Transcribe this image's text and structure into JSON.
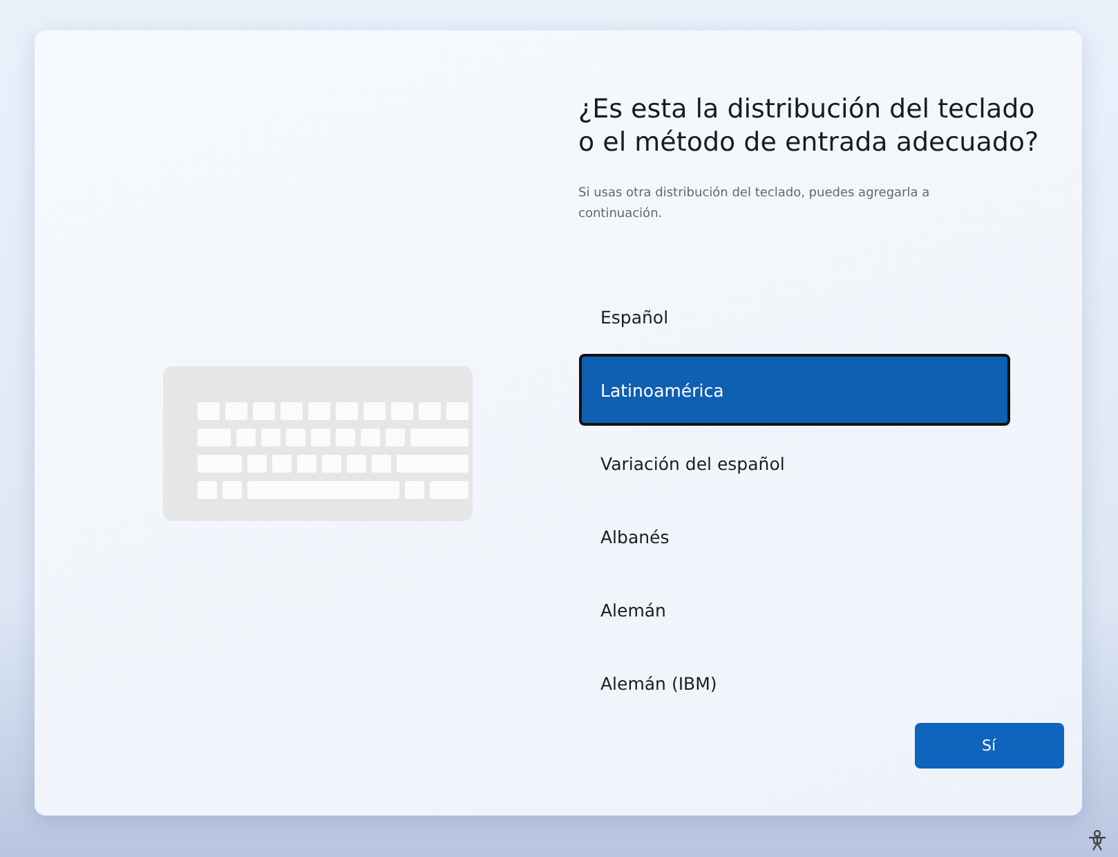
{
  "title": "¿Es esta la distribución del teclado o el método de entrada adecuado?",
  "subtitle": "Si usas otra distribución del teclado, puedes agregarla a continuación.",
  "layouts": [
    {
      "label": "Español",
      "selected": false
    },
    {
      "label": "Latinoamérica",
      "selected": true
    },
    {
      "label": "Variación del español",
      "selected": false
    },
    {
      "label": "Albanés",
      "selected": false
    },
    {
      "label": "Alemán",
      "selected": false
    },
    {
      "label": "Alemán (IBM)",
      "selected": false
    }
  ],
  "buttons": [
    "Sí"
  ]
}
